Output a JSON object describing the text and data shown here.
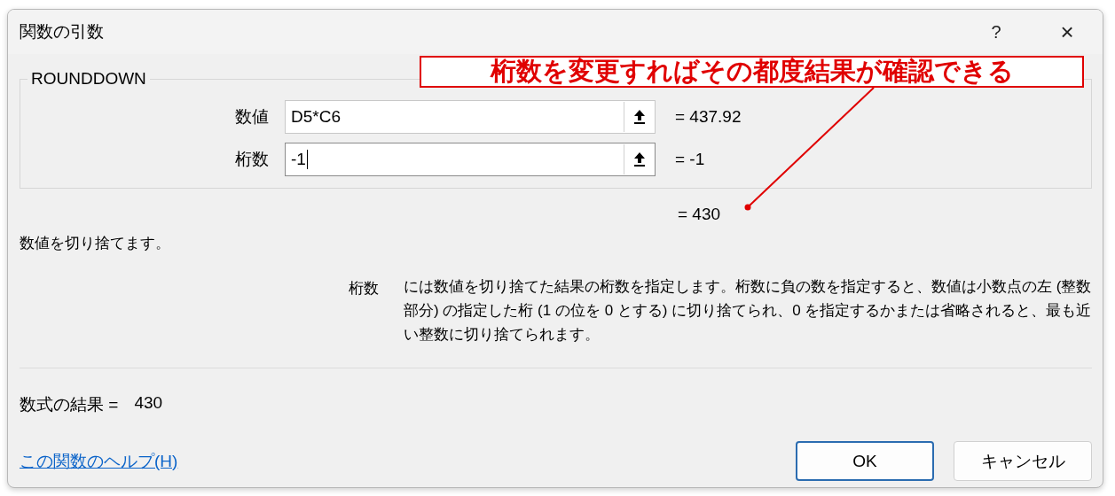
{
  "window": {
    "title": "関数の引数",
    "help": "?",
    "close": "×"
  },
  "function_name": "ROUNDDOWN",
  "arguments": [
    {
      "label": "数値",
      "value": "D5*C6",
      "result": "= 437.92",
      "focused": false
    },
    {
      "label": "桁数",
      "value": "-1",
      "result": "= -1",
      "focused": true
    }
  ],
  "function_result": "= 430",
  "description": "数値を切り捨てます。",
  "argument_help": {
    "label": "桁数",
    "text": "には数値を切り捨てた結果の桁数を指定します。桁数に負の数を指定すると、数値は小数点の左 (整数部分) の指定した桁 (1 の位を 0 とする) に切り捨てられ、0 を指定するかまたは省略されると、最も近い整数に切り捨てられます。"
  },
  "formula_result": {
    "label": "数式の結果 =",
    "value": "430"
  },
  "help_link": "この関数のヘルプ(H)",
  "buttons": [
    {
      "label": "OK",
      "default": true
    },
    {
      "label": "キャンセル",
      "default": false
    }
  ],
  "annotation": {
    "text": "桁数を変更すればその都度結果が確認できる"
  }
}
